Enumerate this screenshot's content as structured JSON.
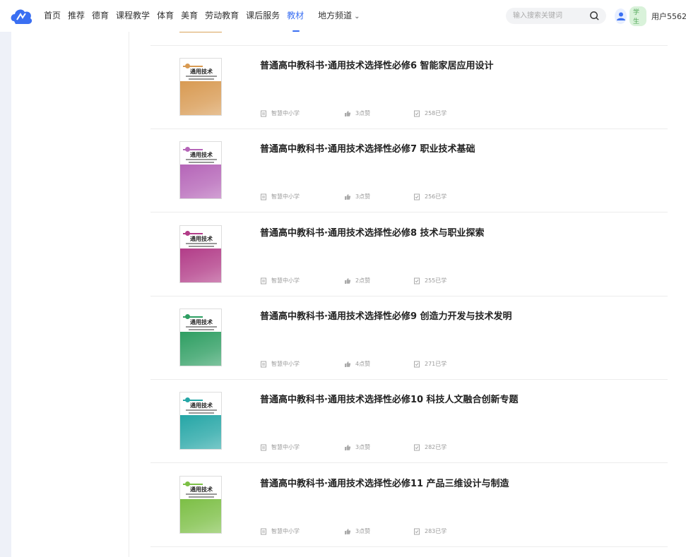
{
  "nav": {
    "items": [
      "首页",
      "推荐",
      "德育",
      "课程教学",
      "体育",
      "美育",
      "劳动教育",
      "课后服务",
      "教材"
    ],
    "active_index": 8,
    "dropdown_label": "地方频道"
  },
  "search": {
    "placeholder": "输入搜索关键词"
  },
  "user": {
    "role_badge": "学生",
    "name": "用户5562"
  },
  "colors": {
    "accent": "#3a6ff2",
    "badge_bg": "#d9f2da",
    "badge_text": "#52a85a"
  },
  "books": [
    {
      "title": "普通高中教科书·通用技术选择性必修6 智能家居应用设计",
      "source": "智慧中小学",
      "likes": "3点赞",
      "learners": "258已学",
      "cover_color": "#d89a52"
    },
    {
      "title": "普通高中教科书·通用技术选择性必修7 职业技术基础",
      "source": "智慧中小学",
      "likes": "3点赞",
      "learners": "256已学",
      "cover_color": "#b565b8"
    },
    {
      "title": "普通高中教科书·通用技术选择性必修8 技术与职业探索",
      "source": "智慧中小学",
      "likes": "2点赞",
      "learners": "255已学",
      "cover_color": "#b23c88"
    },
    {
      "title": "普通高中教科书·通用技术选择性必修9 创造力开发与技术发明",
      "source": "智慧中小学",
      "likes": "4点赞",
      "learners": "271已学",
      "cover_color": "#2e9e62"
    },
    {
      "title": "普通高中教科书·通用技术选择性必修10 科技人文融合创新专题",
      "source": "智慧中小学",
      "likes": "3点赞",
      "learners": "282已学",
      "cover_color": "#25a6a6"
    },
    {
      "title": "普通高中教科书·通用技术选择性必修11 产品三维设计与制造",
      "source": "智慧中小学",
      "likes": "3点赞",
      "learners": "283已学",
      "cover_color": "#7cbf45"
    }
  ],
  "cover_title": "通用技术"
}
